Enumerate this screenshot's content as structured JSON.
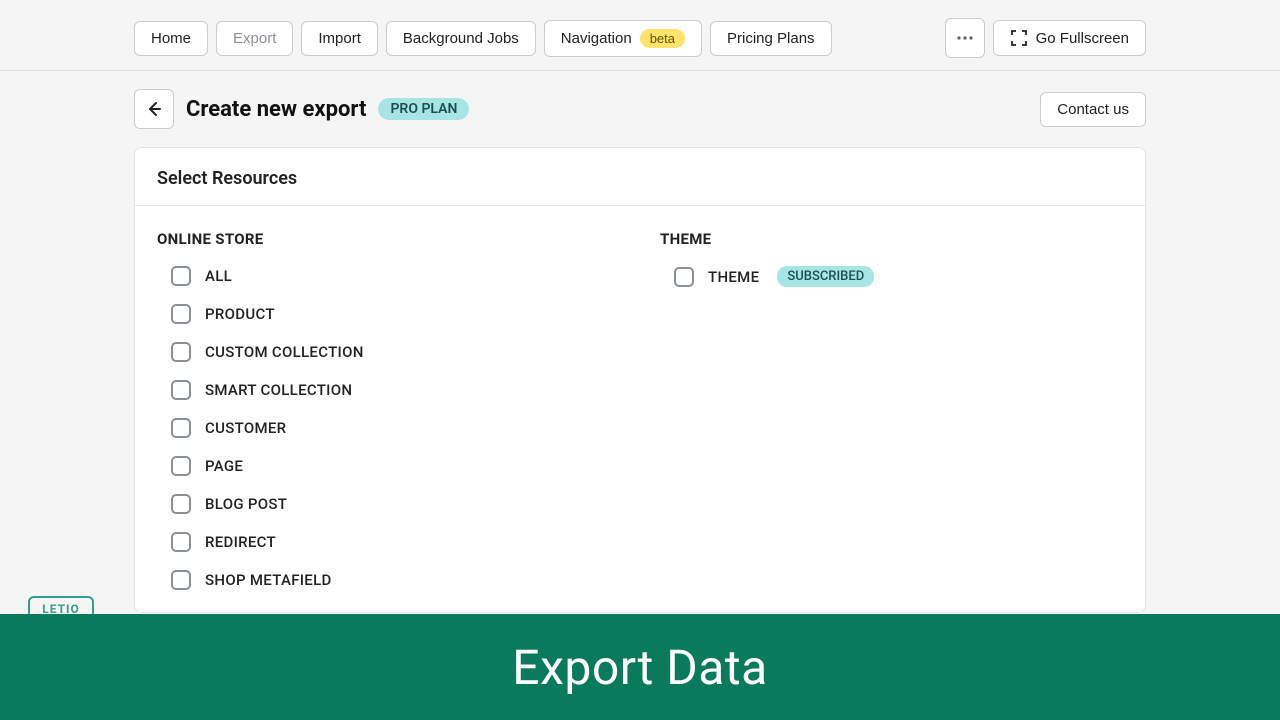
{
  "nav": {
    "home": "Home",
    "export": "Export",
    "import": "Import",
    "background_jobs": "Background Jobs",
    "navigation": "Navigation",
    "navigation_badge": "beta",
    "pricing_plans": "Pricing Plans",
    "go_fullscreen": "Go Fullscreen"
  },
  "header": {
    "title": "Create new export",
    "plan_badge": "PRO PLAN",
    "contact": "Contact us"
  },
  "card": {
    "title": "Select Resources",
    "online_store": {
      "heading": "ONLINE STORE",
      "items": [
        "ALL",
        "PRODUCT",
        "CUSTOM COLLECTION",
        "SMART COLLECTION",
        "CUSTOMER",
        "PAGE",
        "BLOG POST",
        "REDIRECT",
        "SHOP METAFIELD"
      ]
    },
    "theme": {
      "heading": "THEME",
      "item": "THEME",
      "badge": "SUBSCRIBED"
    }
  },
  "logo": "LETIO",
  "banner": "Export Data"
}
